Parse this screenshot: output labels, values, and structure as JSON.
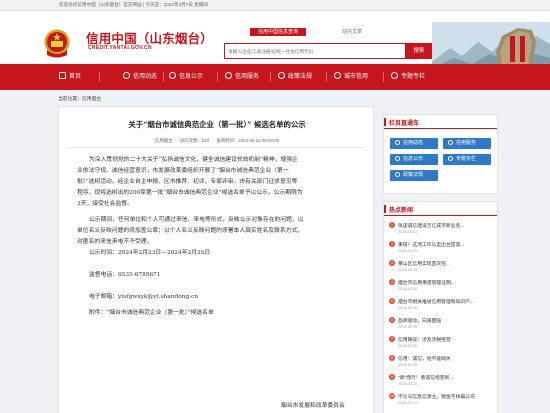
{
  "topbar": {
    "text": "欢迎访问信用中国（山东烟台）官方网站 | 今天是：2024年3月7日 星期四"
  },
  "header": {
    "site_title": "信用中国（山东烟台）",
    "site_url": "CREDIT.YANTAI.GOV.CN",
    "tab_active": "信用中国信息查询",
    "tab_other": "站内文章",
    "search_placeholder": "请输入企业/工商注册号/统一社会信用代码...",
    "search_button": "搜索"
  },
  "nav": [
    {
      "label": "首页",
      "icon": "home-icon"
    },
    {
      "label": "信用动态",
      "icon": "news-icon"
    },
    {
      "label": "信息公示",
      "icon": "notice-icon"
    },
    {
      "label": "信用服务",
      "icon": "service-icon"
    },
    {
      "label": "政策法规",
      "icon": "policy-icon"
    },
    {
      "label": "城市信用",
      "icon": "city-icon"
    },
    {
      "label": "专题专栏",
      "icon": "topic-icon"
    }
  ],
  "breadcrumb": {
    "prefix": "当前位置：",
    "link": "信用烟台"
  },
  "article": {
    "title": "关于“烟台市诚信典范企业（第一批）” 候选名单的公示",
    "source": "信用烟台",
    "views": "访问次数：210",
    "date": "发布时间：2024-02-23 00:00:00",
    "paragraphs": [
      "为深入贯彻党的二十大关于“弘扬诚信文化，健全诚信建设长效机制”精神，增强企",
      "业依法守规、诚信经营意识，市发展改革委组织开展了“烟台市诚信典范企业（第一",
      "批）”选树活动。经企业自主申报、区市推荐、初评、专家评审，市有关部门征求意见等",
      "程序，现将选树出的200家第一批“烟台市诚信典范企业”候选名单予以公示，公示期限为",
      "3天，接受社会监督。",
      "公示期间，任何单位和个人可通过来信、来电等形式，反映公示对象存在的问题，以",
      "单位名义反映问题的须加盖公章；以个人名义反映问题的须署本人真实姓名及联系方式。",
      "对匿名的来信来电不予受理。",
      "公示时间：2024年2月23日—2024年2月25日",
      "监督电话：0535-6785671",
      "电子邮箱：ytsfgwxyk@yt.shandong.cn",
      "附件：“烟台市诚信典范企业（第一批）”候选名单"
    ],
    "signature": "烟台市发展和改革委员会"
  },
  "sidebar": {
    "quick_title": "栏目直通车",
    "quick_links": [
      "信用动态",
      "信用服务",
      "信息公示",
      "专题专栏",
      "政策法规"
    ],
    "hot_title": "热点新闻",
    "hot_news": [
      {
        "title": "张店诚信建设万亿成市新业务...",
        "date": "2024-03-01"
      },
      {
        "title": "重磅！这项工作认定出台提高...",
        "date": "2024-03-01"
      },
      {
        "title": "莱山区信用实现首次在...",
        "date": "2024-02-29"
      },
      {
        "title": "烟台市信用承诺管理证明...",
        "date": "2024-02-29"
      },
      {
        "title": "烟台市相关推进信用管理和知识产...",
        "date": "2024-02-29"
      },
      {
        "title": "品牌驱动，向海图强",
        "date": "2024-02-29"
      },
      {
        "title": "信用铸谈：涉及涉税经营",
        "date": "2024-02-29"
      },
      {
        "title": "信用：诚信，地不能缺失",
        "date": "2024-02-29"
      },
      {
        "title": "\"新\"而行！看诚信经营新...",
        "date": "2024-02-29"
      },
      {
        "title": "不论与信息信源主，锦金不样编公司",
        "date": "2024-02-29"
      }
    ]
  },
  "colors": {
    "brand": "#c4161c",
    "quick_button": "#2f79c5",
    "hot_num": "#e0523a"
  }
}
